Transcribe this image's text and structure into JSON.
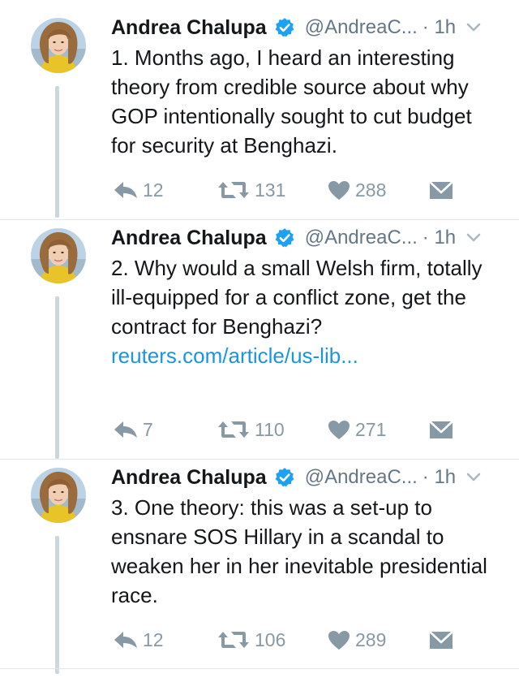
{
  "tweets": [
    {
      "author": "Andrea Chalupa",
      "handle": "@AndreaC...",
      "time": "· 1h",
      "text": "1. Months ago, I heard an interesting theory from credible source about why GOP intentionally sought to cut budget for security at Benghazi.",
      "link": "",
      "replies": "12",
      "retweets": "131",
      "likes": "288"
    },
    {
      "author": "Andrea Chalupa",
      "handle": "@AndreaC...",
      "time": "· 1h",
      "text": "2. Why would a small Welsh firm, totally ill-equipped for a conflict zone, get the contract for Benghazi? ",
      "link": "reuters.com/article/us-lib...",
      "replies": "7",
      "retweets": "110",
      "likes": "271"
    },
    {
      "author": "Andrea Chalupa",
      "handle": "@AndreaC...",
      "time": "· 1h",
      "text": "3. One theory: this was a set-up to ensnare SOS Hillary in a scandal to weaken her in her inevitable presidential race.",
      "link": "",
      "replies": "12",
      "retweets": "106",
      "likes": "289"
    }
  ],
  "icons": {
    "verified": "verified-badge-icon",
    "caret": "chevron-down-icon",
    "reply": "reply-icon",
    "retweet": "retweet-icon",
    "like": "heart-icon",
    "dm": "envelope-icon"
  },
  "colors": {
    "verified_blue": "#1da1f2",
    "link_blue": "#1b95e0",
    "action_gray": "#8899a6",
    "thread_line": "#ccd6dd"
  }
}
